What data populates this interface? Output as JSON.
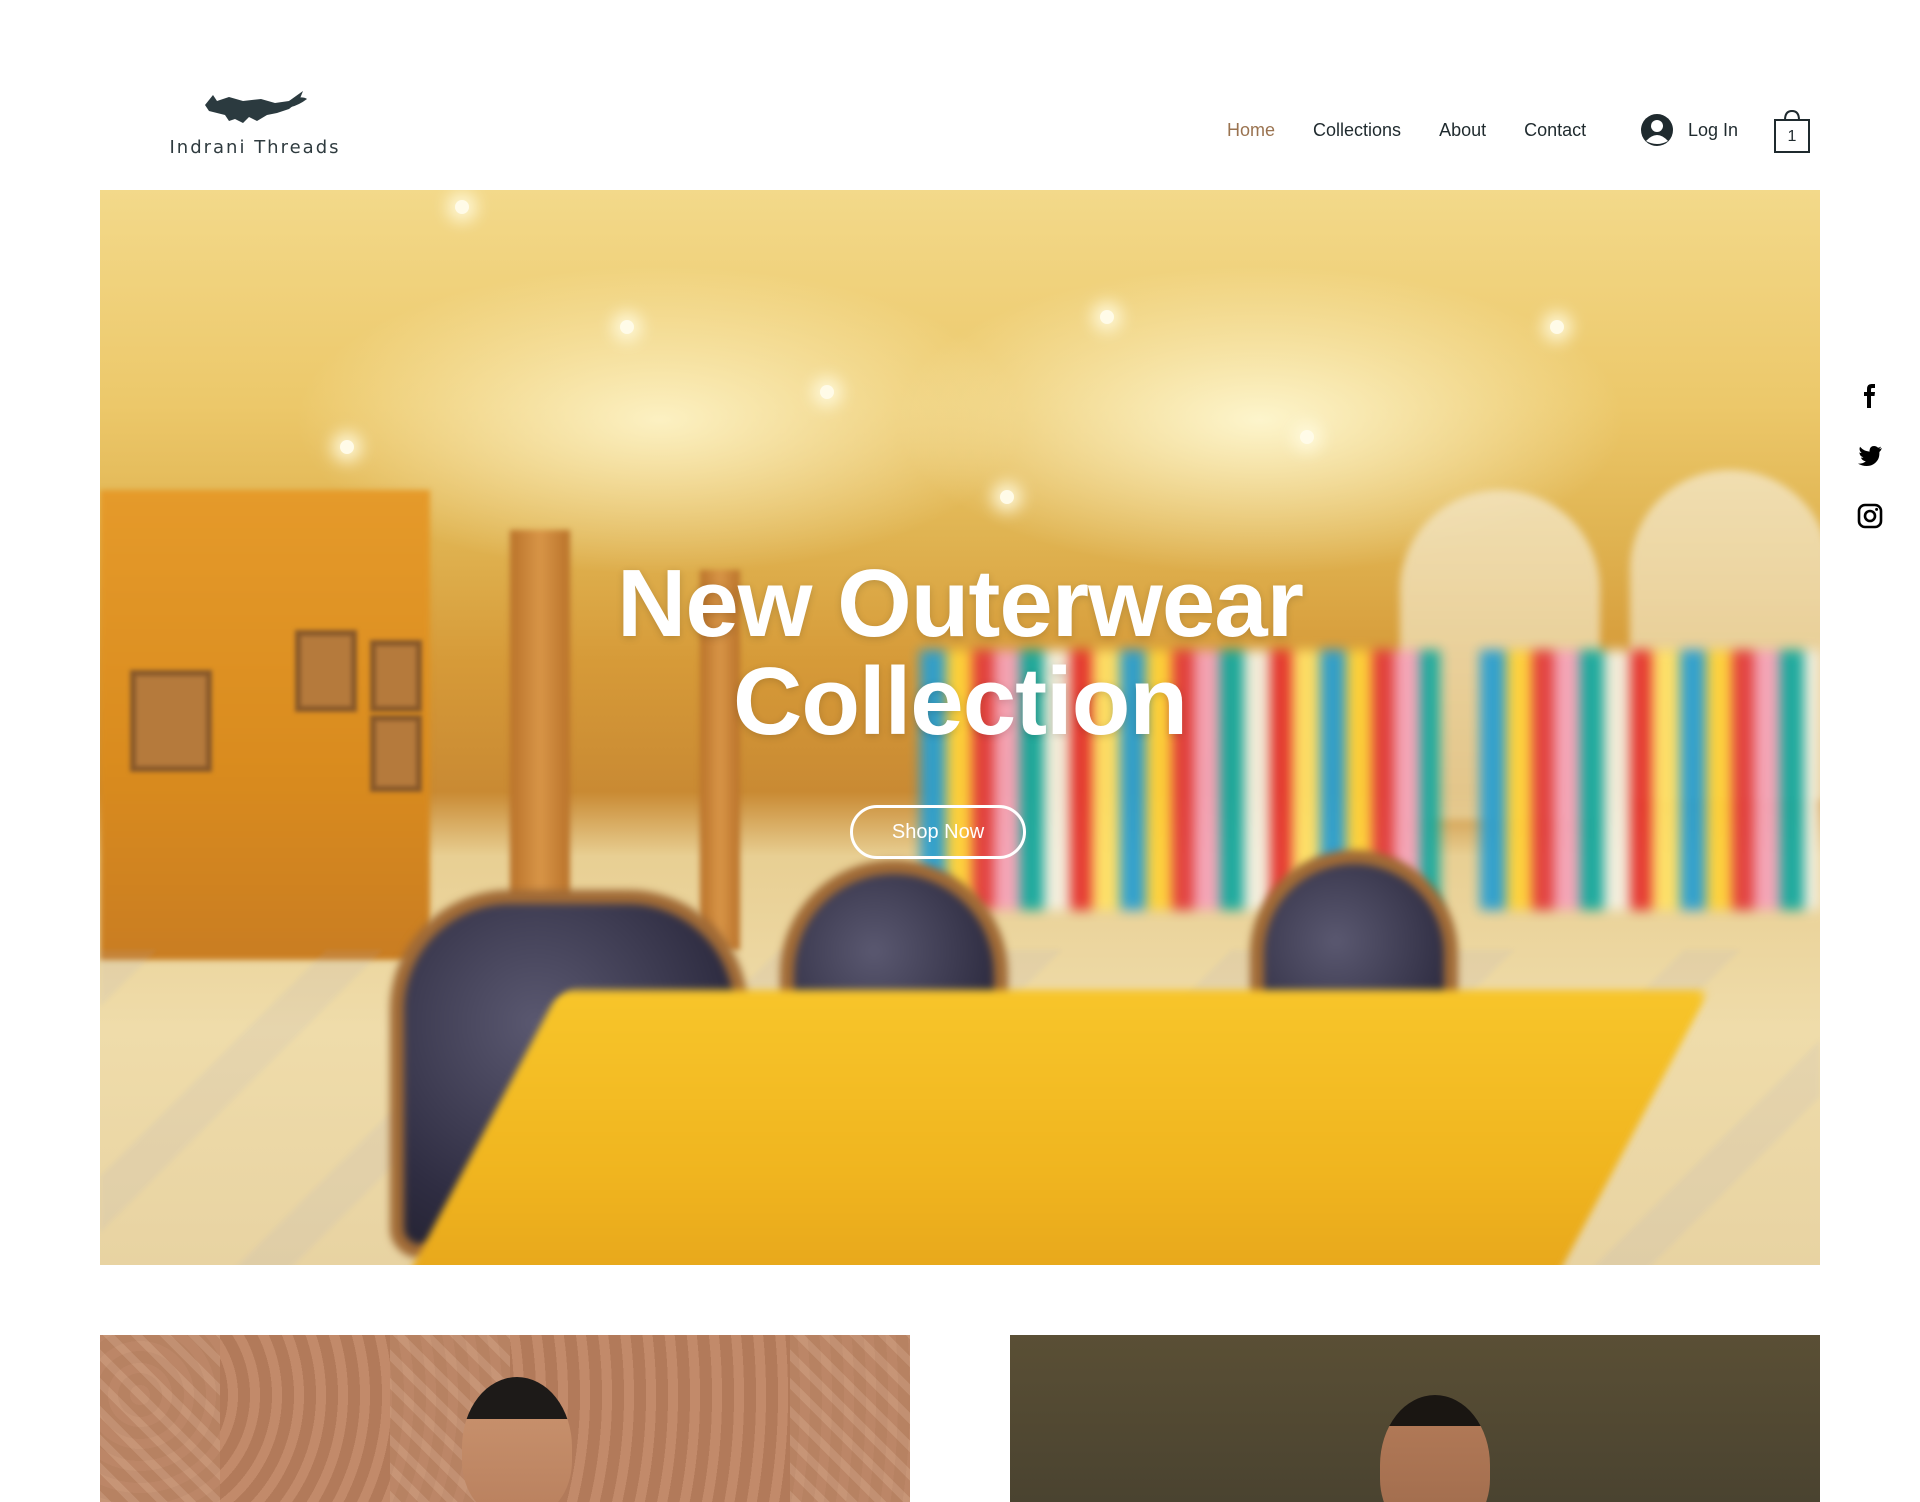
{
  "brand": {
    "name": "Indrani Threads",
    "logo_icon": "fox-icon"
  },
  "nav": {
    "items": [
      {
        "label": "Home",
        "active": true
      },
      {
        "label": "Collections",
        "active": false
      },
      {
        "label": "About",
        "active": false
      },
      {
        "label": "Contact",
        "active": false
      }
    ]
  },
  "account": {
    "login_label": "Log In",
    "icon": "user-avatar-icon"
  },
  "cart": {
    "count": "1",
    "icon": "shopping-bag-icon"
  },
  "social": [
    {
      "name": "facebook-icon"
    },
    {
      "name": "twitter-icon"
    },
    {
      "name": "instagram-icon"
    }
  ],
  "hero": {
    "title_line1": "New Outerwear",
    "title_line2": "Collection",
    "cta_label": "Shop Now"
  },
  "colors": {
    "accent_nav_active": "#9a7350",
    "text_dark": "#1f2a2e"
  }
}
